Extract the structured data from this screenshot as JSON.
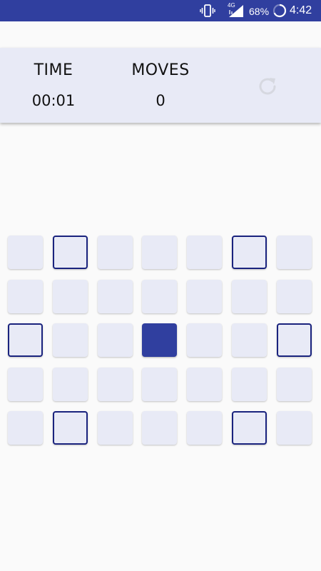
{
  "status_bar": {
    "battery_percent": "68%",
    "time": "4:42",
    "network_label": "4G",
    "icons": [
      "vibrate-icon",
      "signal-icon",
      "battery-icon"
    ]
  },
  "scoreboard": {
    "time_label": "TIME",
    "time_value": "00:01",
    "moves_label": "MOVES",
    "moves_value": "0",
    "reset_icon": "refresh-icon"
  },
  "colors": {
    "primary": "#303f9f",
    "outline": "#1a237e",
    "tile": "#e8eaf6",
    "background": "#fafafa",
    "reset_icon": "#d6d8e0"
  },
  "board": {
    "rows": 5,
    "cols": 7,
    "cells": [
      [
        "empty",
        "outlined",
        "empty",
        "empty",
        "empty",
        "outlined",
        "empty"
      ],
      [
        "empty",
        "empty",
        "empty",
        "empty",
        "empty",
        "empty",
        "empty"
      ],
      [
        "outlined",
        "empty",
        "empty",
        "filled",
        "empty",
        "empty",
        "outlined"
      ],
      [
        "empty",
        "empty",
        "empty",
        "empty",
        "empty",
        "empty",
        "empty"
      ],
      [
        "empty",
        "outlined",
        "empty",
        "empty",
        "empty",
        "outlined",
        "empty"
      ]
    ]
  }
}
